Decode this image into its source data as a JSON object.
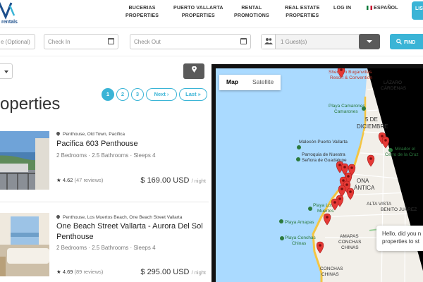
{
  "header": {
    "logo_text": "rentals",
    "nav": [
      {
        "line1": "BUCERIAS",
        "line2": "PROPERTIES"
      },
      {
        "line1": "PUERTO VALLARTA",
        "line2": "PROPERTIES"
      },
      {
        "line1": "RENTAL",
        "line2": "PROMOTIONS"
      },
      {
        "line1": "REAL ESTATE",
        "line2": "PROPERTIES"
      }
    ],
    "login": "LOG IN",
    "language": "ESPAÑOL",
    "list_button": "LIST"
  },
  "search": {
    "destination_placeholder": "e (Optional)",
    "checkin_placeholder": "Check In",
    "checkout_placeholder": "Check Out",
    "guests_value": "1 Guest(s)",
    "find_label": "FIND"
  },
  "results": {
    "heading": "roperties",
    "pages": [
      "1",
      "2",
      "3"
    ],
    "next_label": "Next ›",
    "last_label": "Last »"
  },
  "listings": [
    {
      "location": "Penthouse, Old Town, Pacifica",
      "title": "Pacifica 603 Penthouse",
      "specs": "2 Bedrooms · 2.5 Bathrooms · Sleeps 4",
      "rating": "4.62",
      "reviews": "(47 reviews)",
      "price": "$ 169.00 USD",
      "per": "/ night"
    },
    {
      "location": "Penthouse, Los Muertos Beach, One Beach Street Vallarta",
      "title": "One Beach Street Vallarta - Aurora Del Sol Penthouse",
      "specs": "2 Bedrooms · 2.5 Bathrooms · Sleeps 4",
      "rating": "4.69",
      "reviews": "(89 reviews)",
      "price": "$ 295.00 USD",
      "per": "/ night"
    }
  ],
  "map": {
    "tab_map": "Map",
    "tab_satellite": "Satellite",
    "labels": {
      "sheraton": "Sheraton Buganvilias",
      "sheraton2": "Resort & Convention",
      "lazaro": "LÁZARO",
      "cardenas": "CÁRDENAS",
      "camarones": "Playa Camarones",
      "camarones2": "Camarones",
      "dic1": "5 DE",
      "dic2": "DICIEMBRE",
      "malecon": "Malecón Puerto Vallarta",
      "parroquia1": "Parroquia de Nuestra",
      "parroquia2": "Señora de Guadalupe",
      "mirador1": "Mirador el",
      "mirador2": "Cerro de la Cruz",
      "losmuertos1": "Playa Los",
      "losmuertos2": "Muertos",
      "romantica1": "ONA",
      "romantica2": "ÁNTICA",
      "altavista": "ALTA VISTA",
      "benito": "BENITO JUÁREZ",
      "amapas_beach": "Playa Amapas",
      "amapas1": "AMAPAS",
      "amapas2": "CONCHAS",
      "amapas3": "CHINAS",
      "conchas1": "Playa Conchas",
      "conchas2": "Chinas",
      "conchas3": "CONCHAS",
      "conchas4": "CHINAS"
    }
  },
  "chat": {
    "line1": "Hello, did you n",
    "line2": "properties to st"
  }
}
